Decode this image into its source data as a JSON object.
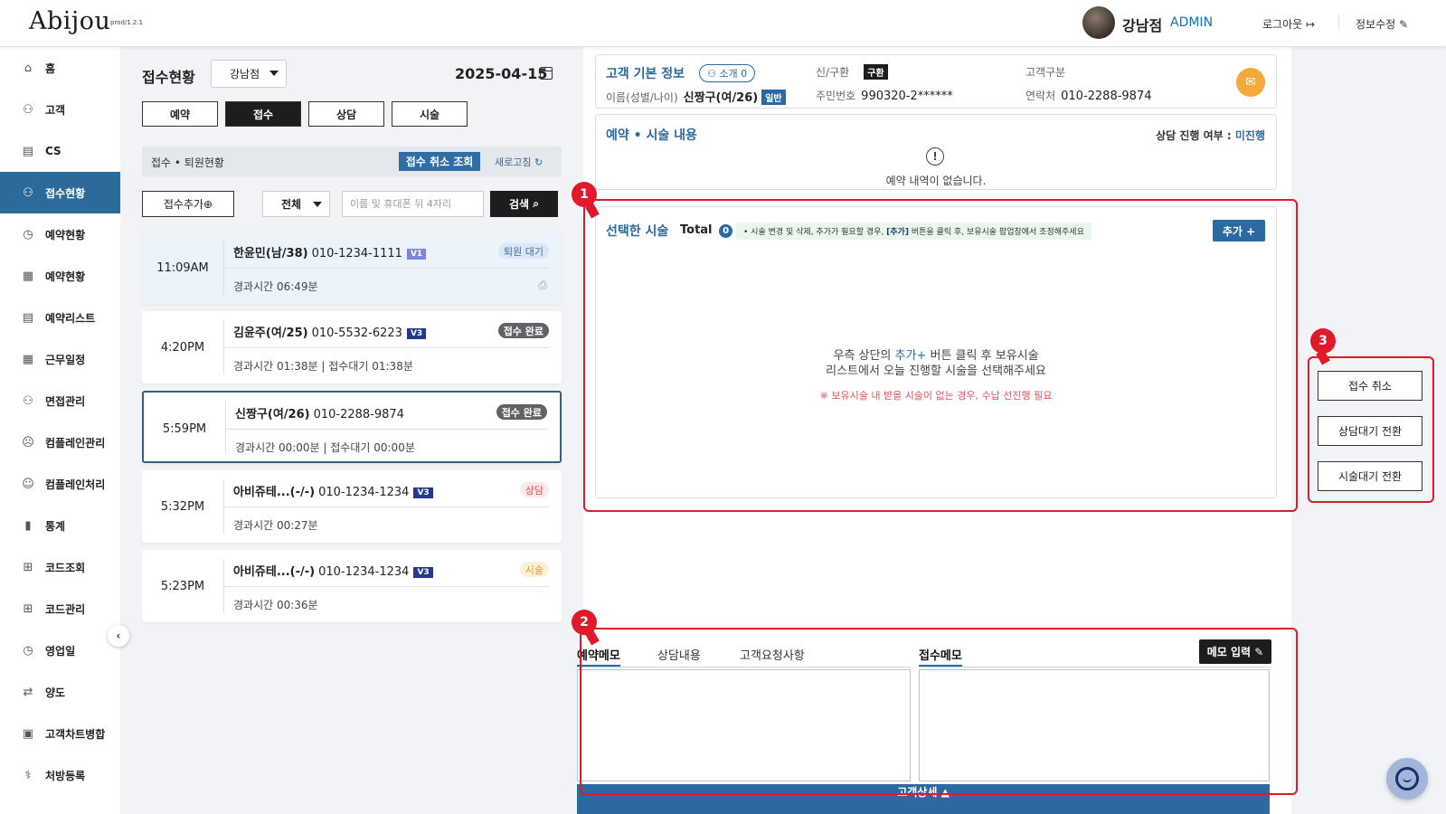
{
  "header": {
    "logo": "Abijou",
    "version": "prod/1.2.1",
    "branch": "강남점",
    "role": "ADMIN",
    "logout": "로그아웃",
    "edit_info": "정보수정"
  },
  "sidebar": {
    "items": [
      {
        "label": "홈",
        "icon": "home-icon"
      },
      {
        "label": "고객",
        "icon": "users-icon"
      },
      {
        "label": "CS",
        "icon": "cs-document-icon"
      },
      {
        "label": "접수현황",
        "icon": "reception-icon",
        "active": true
      },
      {
        "label": "예약현황",
        "icon": "calendar-clock-icon"
      },
      {
        "label": "예약현황",
        "icon": "calendar-building-icon"
      },
      {
        "label": "예약리스트",
        "icon": "list-edit-icon"
      },
      {
        "label": "근무일정",
        "icon": "schedule-icon"
      },
      {
        "label": "면접관리",
        "icon": "interview-icon"
      },
      {
        "label": "컴플레인관리",
        "icon": "complaint-face-icon"
      },
      {
        "label": "컴플레인처리",
        "icon": "smile-face-icon"
      },
      {
        "label": "통계",
        "icon": "chart-icon"
      },
      {
        "label": "코드조회",
        "icon": "org-tree-icon"
      },
      {
        "label": "코드관리",
        "icon": "org-tree-edit-icon"
      },
      {
        "label": "영업일",
        "icon": "business-day-icon"
      },
      {
        "label": "양도",
        "icon": "transfer-icon"
      },
      {
        "label": "고객차트병합",
        "icon": "merge-chart-icon"
      },
      {
        "label": "처방등록",
        "icon": "prescription-icon"
      }
    ]
  },
  "reception": {
    "title": "접수현황",
    "branch_select": "강남점",
    "date": "2025-04-15",
    "tabs": [
      "예약",
      "접수",
      "상담",
      "시술"
    ],
    "active_tab": "접수",
    "status_label": "접수 • 퇴원현황",
    "cancel_view": "접수 취소 조회",
    "refresh": "새로고침",
    "add_reception": "접수추가",
    "filter": "전체",
    "search_placeholder": "이름 및 휴대폰 뒤 4자리",
    "search_btn": "검색",
    "cards": [
      {
        "time": "11:09AM",
        "name": "한윤민(남/38)",
        "phone": "010-1234-1111",
        "grade": "V1",
        "status": "퇴원 대기",
        "status_type": "wait",
        "elapsed": "경과시간 06:49분"
      },
      {
        "time": "4:20PM",
        "name": "김윤주(여/25)",
        "phone": "010-5532-6223",
        "grade": "V3",
        "status": "접수 완료",
        "status_type": "done",
        "elapsed": "경과시간 01:38분 | 접수대기 01:38분"
      },
      {
        "time": "5:59PM",
        "name": "신짱구(여/26)",
        "phone": "010-2288-9874",
        "grade": "",
        "status": "접수 완료",
        "status_type": "done",
        "elapsed": "경과시간 00:00분 | 접수대기 00:00분"
      },
      {
        "time": "5:32PM",
        "name": "아비쥬테...(-/-)",
        "phone": "010-1234-1234",
        "grade": "V3",
        "status": "상담",
        "status_type": "consult",
        "elapsed": "경과시간 00:27분"
      },
      {
        "time": "5:23PM",
        "name": "아비쥬테...(-/-)",
        "phone": "010-1234-1234",
        "grade": "V3",
        "status": "시술",
        "status_type": "treat",
        "elapsed": "경과시간 00:36분"
      }
    ]
  },
  "customer": {
    "section_title": "고객 기본 정보",
    "intro": "소개 0",
    "name_label": "이름(성별/나이)",
    "name": "신짱구(여/26)",
    "name_badge": "일반",
    "newold_label": "신/구환",
    "newold_badge": "구환",
    "rrn_label": "주민번호",
    "rrn": "990320-2******",
    "type_label": "고객구분",
    "contact_label": "연락처",
    "contact": "010-2288-9874"
  },
  "reservation": {
    "title": "예약 • 시술 내용",
    "consult_label": "상담 진행 여부 :",
    "consult_value": "미진행",
    "empty": "예약 내역이 없습니다."
  },
  "treatment": {
    "title": "선택한 시술",
    "total_label": "Total",
    "total": "0",
    "hint_prefix": "• 시술 변경 및 삭제, 추가가 필요할 경우,",
    "hint_bold": "[추가]",
    "hint_suffix": "버튼을 클릭 후, 보유시술 팝업창에서 조정해주세요",
    "add_btn": "추가 +",
    "empty_line1_a": "우측 상단의",
    "empty_line1_hl": "추가+",
    "empty_line1_b": "버튼 클릭 후 보유시술",
    "empty_line2": "리스트에서 오늘 진행할 시술을 선택해주세요",
    "empty_note": "※ 보유시술 내 받을 시술이 없는 경우, 수납 선진행 필요"
  },
  "memo": {
    "tabs": [
      "예약메모",
      "상담내용",
      "고객요청사항"
    ],
    "reception_memo": "접수메모",
    "input_btn": "메모 입력",
    "customer_detail": "고객상세"
  },
  "actions": {
    "cancel": "접수 취소",
    "to_consult": "상담대기 전환",
    "to_treat": "시술대기 전환"
  },
  "annotations": [
    "1",
    "2",
    "3"
  ]
}
